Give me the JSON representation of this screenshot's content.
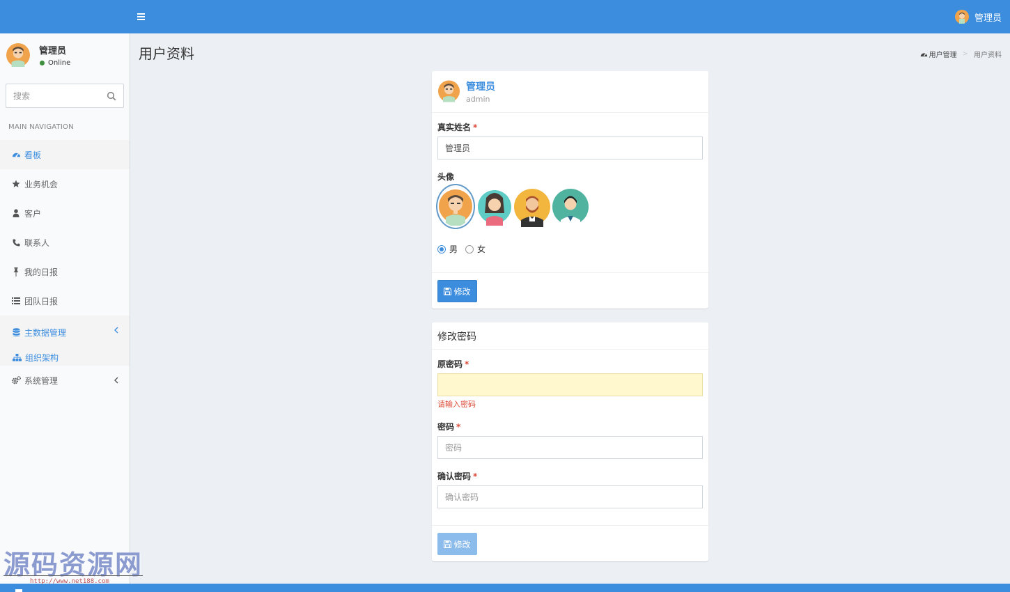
{
  "header": {
    "user_name": "管理员"
  },
  "sidebar": {
    "user": {
      "name": "管理员",
      "status": "Online"
    },
    "search_placeholder": "搜索",
    "nav_header": "MAIN NAVIGATION",
    "items": [
      {
        "label": "看板",
        "icon": "dashboard-icon",
        "active": true
      },
      {
        "label": "业务机会",
        "icon": "star-icon"
      },
      {
        "label": "客户",
        "icon": "user-icon"
      },
      {
        "label": "联系人",
        "icon": "phone-icon"
      },
      {
        "label": "我的日报",
        "icon": "pin-icon"
      },
      {
        "label": "团队日报",
        "icon": "list-icon"
      },
      {
        "label": "主数据管理",
        "icon": "database-icon",
        "expanded": true,
        "children": [
          {
            "label": "组织架构",
            "icon": "sitemap-icon"
          }
        ]
      },
      {
        "label": "系统管理",
        "icon": "gears-icon"
      }
    ]
  },
  "content": {
    "title": "用户资料",
    "breadcrumb": [
      {
        "label": "用户管理",
        "icon": "dashboard-icon"
      },
      {
        "label": "用户资料"
      }
    ]
  },
  "profile": {
    "name": "管理员",
    "login": "admin",
    "real_name_label": "真实姓名",
    "real_name_value": "管理员",
    "avatar_label": "头像",
    "avatars": [
      "avatar-man-glasses",
      "avatar-woman",
      "avatar-man-beard",
      "avatar-woman-doctor"
    ],
    "selected_avatar": 0,
    "gender_options": [
      "男",
      "女"
    ],
    "gender_selected": "男",
    "submit_label": "修改"
  },
  "password": {
    "title": "修改密码",
    "old_label": "原密码",
    "old_error": "请输入密码",
    "new_label": "密码",
    "new_placeholder": "密码",
    "confirm_label": "确认密码",
    "confirm_placeholder": "确认密码",
    "submit_label": "修改"
  },
  "watermark": {
    "title": "源码资源网",
    "url": "http://www.net188.com"
  },
  "colors": {
    "primary": "#3c8dde",
    "required": "#dd4b39",
    "online": "#3d8e3d",
    "warning_bg": "#fff8cf"
  }
}
